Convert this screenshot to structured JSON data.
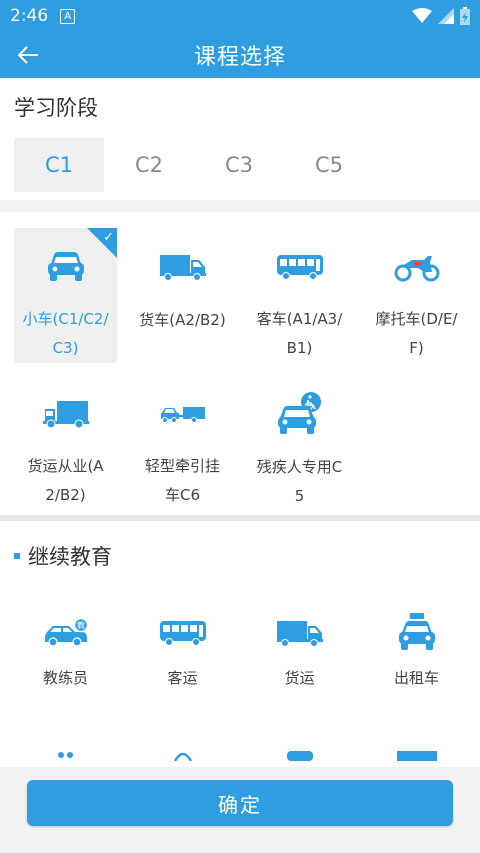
{
  "status_bar": {
    "time": "2:46",
    "notif": "A"
  },
  "app_bar": {
    "title": "课程选择"
  },
  "stage": {
    "label": "学习阶段",
    "tabs": [
      "C1",
      "C2",
      "C3",
      "C5"
    ],
    "selected": "C1"
  },
  "vehicles": [
    {
      "name": "小车(C1/C2/C3)",
      "icon": "car-icon",
      "selected": true
    },
    {
      "name": "货车(A2/B2)",
      "icon": "truck-icon",
      "selected": false
    },
    {
      "name": "客车(A1/A3/B1)",
      "icon": "bus-icon",
      "selected": false
    },
    {
      "name": "摩托车(D/E/F)",
      "icon": "motorcycle-icon",
      "selected": false
    },
    {
      "name": "货运从业(A2/B2)",
      "icon": "cargo-truck-icon",
      "selected": false
    },
    {
      "name": "轻型牵引挂车C6",
      "icon": "trailer-icon",
      "selected": false
    },
    {
      "name": "残疾人专用C5",
      "icon": "accessible-car-icon",
      "selected": false
    }
  ],
  "continuing_education": {
    "title": "继续教育",
    "items": [
      {
        "name": "教练员",
        "icon": "coach-car-icon"
      },
      {
        "name": "客运",
        "icon": "bus-icon"
      },
      {
        "name": "货运",
        "icon": "truck-icon"
      },
      {
        "name": "出租车",
        "icon": "taxi-icon"
      }
    ]
  },
  "confirm_button": {
    "label": "确定"
  },
  "colors": {
    "accent": "#2f9ee0",
    "selected_bg": "#efefef"
  }
}
